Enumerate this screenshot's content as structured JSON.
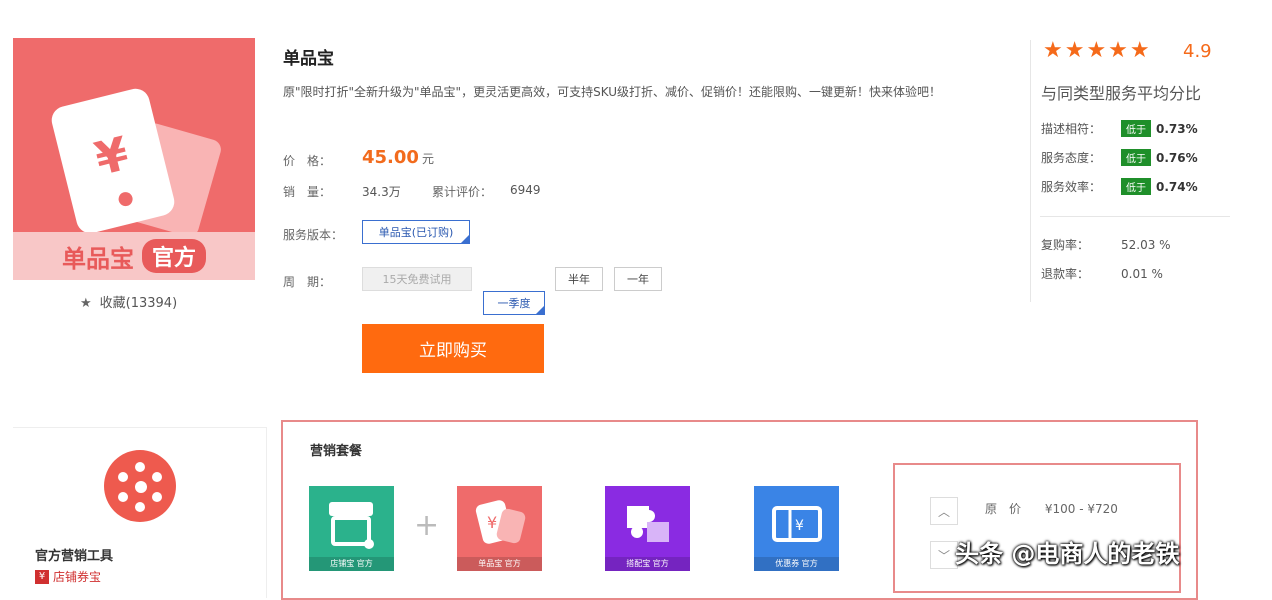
{
  "product": {
    "name": "单品宝",
    "logo_text": "单品宝",
    "logo_badge": "官方",
    "favorites": "收藏(13394)",
    "description": "原\"限时打折\"全新升级为\"单品宝\"，更灵活更高效，可支持SKU级打折、减价、促销价！还能限购、一键更新！快来体验吧！",
    "price_label": "价　格：",
    "price": "45.00",
    "price_unit": "元",
    "sales_label": "销　量：",
    "sales": "34.3万",
    "reviews_label": "累计评价：",
    "reviews": "6949",
    "version_label": "服务版本：",
    "version_option": "单品宝(已订购)",
    "period_label": "周　期：",
    "period_options": [
      "15天免费试用",
      "一季度",
      "半年",
      "一年"
    ],
    "buy_button": "立即购买"
  },
  "rating": {
    "stars": "★★★★★",
    "score": "4.9",
    "subtitle": "与同类型服务平均分比",
    "rows": [
      {
        "label": "描述相符：",
        "badge": "低于",
        "value": "0.73%"
      },
      {
        "label": "服务态度：",
        "badge": "低于",
        "value": "0.76%"
      },
      {
        "label": "服务效率：",
        "badge": "低于",
        "value": "0.74%"
      }
    ],
    "stats": [
      {
        "label": "复购率：",
        "value": "52.03 %"
      },
      {
        "label": "退款率：",
        "value": "0.01 %"
      }
    ]
  },
  "bottom": {
    "tools_title": "官方营销工具",
    "coupon_label": "店铺券宝",
    "section_title": "营销套餐",
    "apps": [
      {
        "caption": "店铺宝 官方",
        "color": "#2bb28c"
      },
      {
        "caption": "单品宝 官方",
        "color": "#ef6b6b"
      },
      {
        "caption": "搭配宝 官方",
        "color": "#8a2be2"
      },
      {
        "caption": "优惠券 官方",
        "color": "#3a84e6"
      }
    ],
    "plus": "+",
    "price_range_label": "原　价",
    "price_range": "¥100 - ¥720",
    "up_arrow": "︿",
    "down_arrow": "﹀"
  },
  "watermark": "头条 @电商人的老铁"
}
